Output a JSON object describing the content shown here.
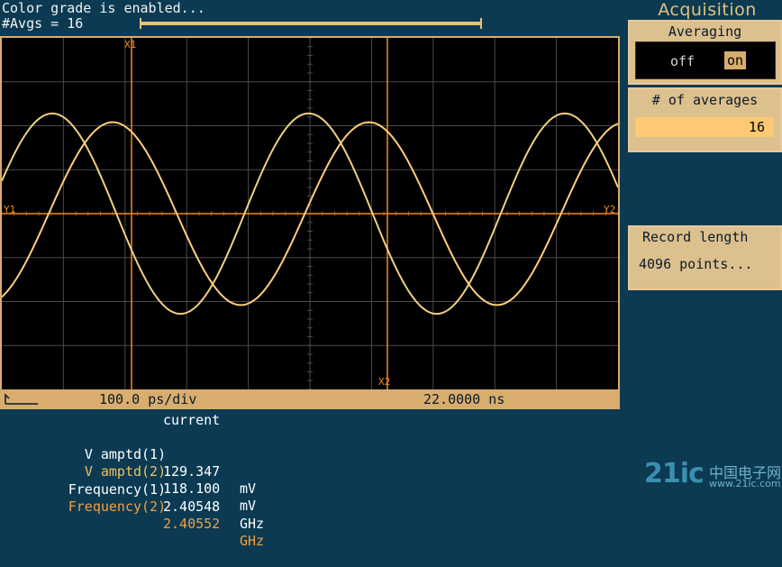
{
  "status": {
    "line1": "Color grade is enabled...",
    "line2": "#Avgs = 16"
  },
  "scope": {
    "timebase": "100.0 ps/div",
    "trigger_position": "22.0000 ns",
    "markers": {
      "x1": "X1",
      "x2": "X2",
      "y1": "Y1",
      "y2": "Y2"
    },
    "grid": {
      "h_divisions": 10,
      "v_divisions": 8
    },
    "waveforms": [
      {
        "channel": 1,
        "color": "#f0d080",
        "amplitude_div": 2.28,
        "period_div": 4.158,
        "phase_div": 0.82
      },
      {
        "channel": 2,
        "color": "#ffcf7a",
        "amplitude_div": 2.08,
        "period_div": 4.157,
        "phase_div": 1.8
      }
    ],
    "colors": {
      "grid": "#4a4a4a",
      "marker": "#f08a20",
      "frame": "#d9ad6e"
    }
  },
  "acquisition": {
    "title": "Acquisition",
    "averaging": {
      "label": "Averaging",
      "off": "off",
      "on": "on",
      "state": "on"
    },
    "num_averages": {
      "label": "# of averages",
      "value": "16"
    },
    "record_length": {
      "label": "Record length",
      "value": "4096 points..."
    }
  },
  "measurements": {
    "header": "current",
    "rows": [
      {
        "label": "V amptd(1)",
        "value": "129.347",
        "unit": "mV",
        "color": "#ffffff"
      },
      {
        "label": "V amptd(2)",
        "value": "118.100",
        "unit": "mV",
        "color": "#ffffff"
      },
      {
        "label": "Frequency(1)",
        "value": "2.40548",
        "unit": "GHz",
        "color": "#ffffff"
      },
      {
        "label": "Frequency(2)",
        "value": "2.40552",
        "unit": "GHz",
        "color": "#f2a040"
      }
    ],
    "label_highlight_colors": [
      "#ffffff",
      "#f2c060",
      "#ffffff",
      "#f2a040"
    ]
  },
  "watermark": {
    "main": "21ic",
    "cn": "中国电子网",
    "url": "www.21ic.com"
  }
}
